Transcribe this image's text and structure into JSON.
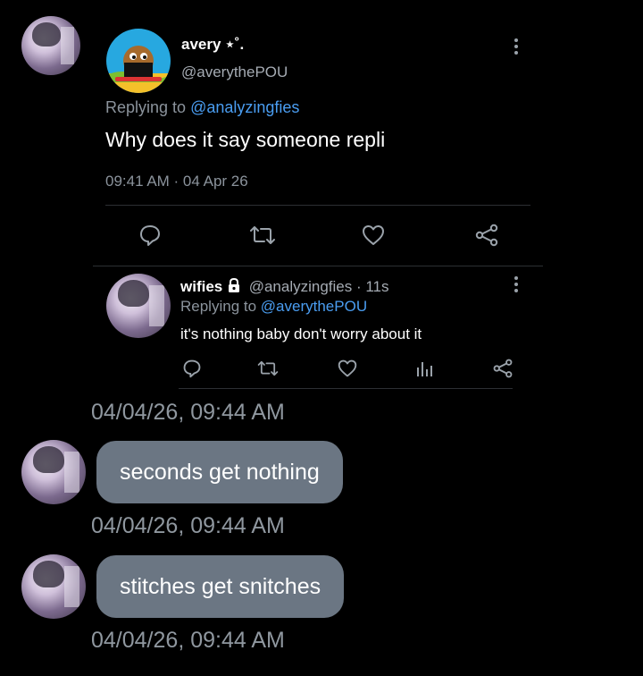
{
  "tweet": {
    "display_name": "avery ⋆˚.",
    "handle": "@averythePOU",
    "replying_prefix": "Replying to",
    "replying_to": "@analyzingfies",
    "text": "Why does it say someone repli",
    "timestamp": "09:41 AM · 04 Apr 26"
  },
  "reply": {
    "display_name": "wifies",
    "handle_time": "@analyzingfies · 11s",
    "replying_prefix": "Replying to",
    "replying_to": "@averythePOU",
    "text": "it's nothing baby don't worry about it"
  },
  "messages": [
    {
      "timestamp": "04/04/26, 09:44 AM"
    },
    {
      "text": "seconds get nothing",
      "timestamp": "04/04/26, 09:44 AM"
    },
    {
      "text": "stitches get snitches",
      "timestamp": "04/04/26, 09:44 AM"
    }
  ],
  "colors": {
    "link": "#4a9df1",
    "bubble": "#6b7683",
    "background": "#000000"
  }
}
